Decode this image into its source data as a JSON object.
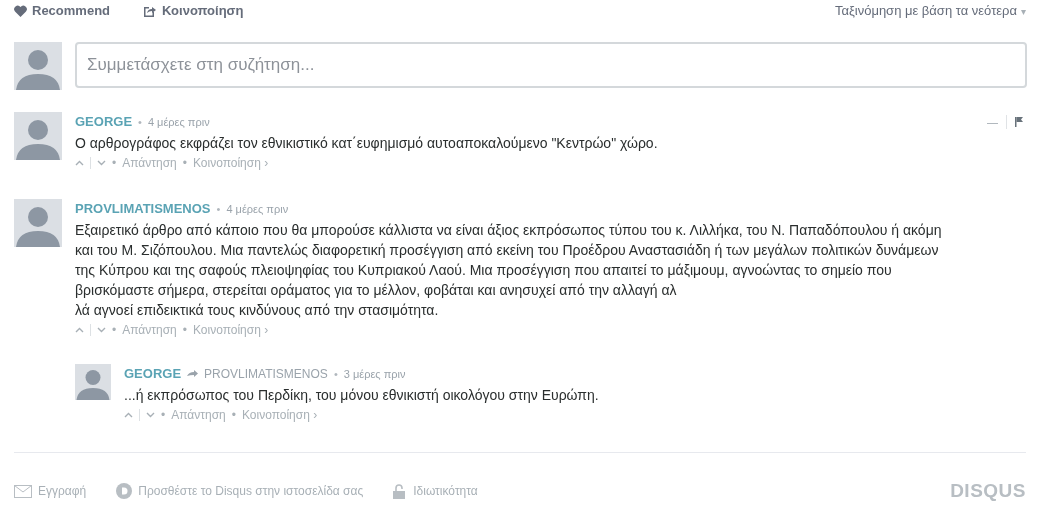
{
  "top_bar": {
    "recommend": "Recommend",
    "share": "Κοινοποίηση",
    "sort": "Ταξινόμηση με βάση τα νεότερα",
    "sort_caret": "▾"
  },
  "composer": {
    "placeholder": "Συμμετάσχετε στη συζήτηση..."
  },
  "separator": "•",
  "comments": [
    {
      "author": "GEORGE",
      "time": "4 μέρες πριν",
      "tools": {
        "collapse": "—"
      },
      "body": [
        "Ο αρθρογράφος εκφράζει τον εθνικιστικό κατ΄ευφημισμό αυτοαποκαλούμενο \"Κεντρώο\" χώρο."
      ],
      "reply": "Απάντηση",
      "share": "Κοινοποίηση ›"
    },
    {
      "author": "PROVLIMATISMENOS",
      "time": "4 μέρες πριν",
      "body": [
        "Εξαιρετικό άρθρο από κάποιο που θα μπορούσε κάλλιστα να είναι άξιος εκπρόσωπος τύπου του κ. Λιλλήκα, του Ν. Παπαδόπουλου ή ακόμη",
        "και του Μ. Σιζόπουλου. Μια παντελώς διαφορετική προσέγγιση από εκείνη του Προέδρου Αναστασιάδη ή των μεγάλων πολιτικών δυνάμεων",
        "της Κύπρου και της σαφούς πλειοψηφίας του Κυπριακού Λαού. Μια προσέγγιση που απαιτεί το μάξιμουμ, αγνοώντας το σημείο που",
        "βρισκόμαστε σήμερα, στερείται οράματος για το μέλλον, φοβάται και ανησυχεί από την αλλαγή αλ",
        "λά αγνοεί επιδεικτικά τους κινδύνους από την στασιμότητα."
      ],
      "reply": "Απάντηση",
      "share": "Κοινοποίηση ›",
      "children": [
        {
          "author": "GEORGE",
          "in_reply_to": "PROVLIMATISMENOS",
          "time": "3 μέρες πριν",
          "body": [
            "...ή εκπρόσωπος του Περδίκη, του μόνου εθνικιστή οικολόγου στην Ευρώπη."
          ],
          "reply": "Απάντηση",
          "share": "Κοινοποίηση ›"
        }
      ]
    }
  ],
  "footer": {
    "subscribe": "Εγγραφή",
    "add_disqus": "Προσθέστε το Disqus στην ιστοσελίδα σας",
    "privacy": "Ιδιωτικότητα",
    "brand": "DISQUS"
  }
}
